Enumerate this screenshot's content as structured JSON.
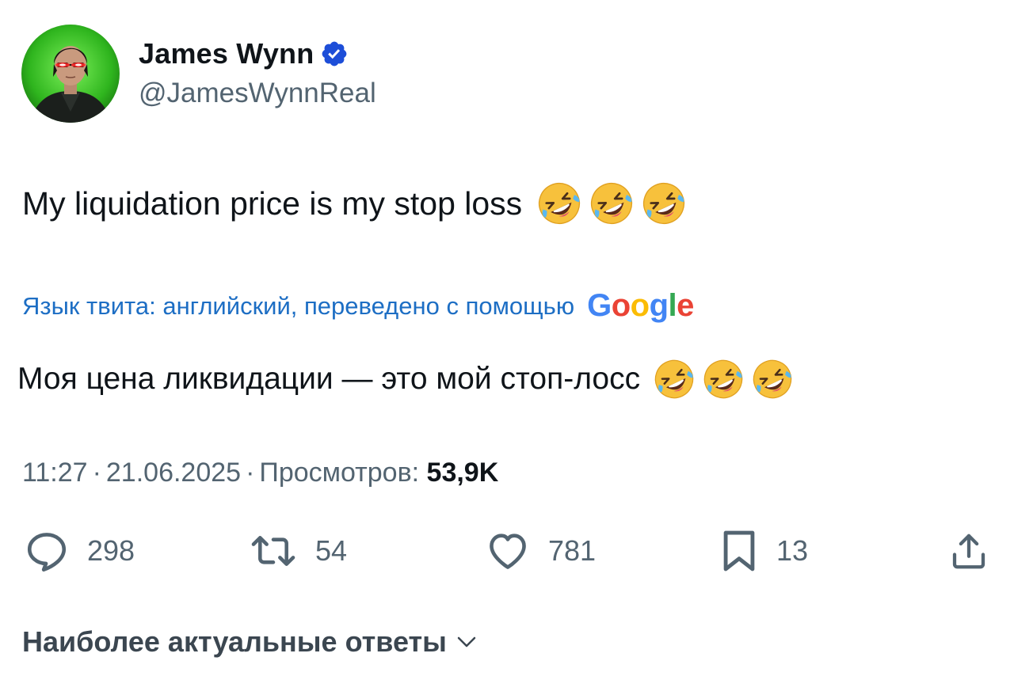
{
  "author": {
    "display_name": "James Wynn",
    "handle": "@JamesWynnReal",
    "verified_color": "#1d4ed8"
  },
  "tweet": {
    "text": "My liquidation price is my stop loss",
    "emojis": [
      "rolling-on-floor-laughing",
      "rolling-on-floor-laughing",
      "rolling-on-floor-laughing"
    ]
  },
  "translation": {
    "label": "Язык твита: английский, переведено с помощью",
    "provider": "Google",
    "text": "Моя цена ликвидации — это мой стоп-лосс"
  },
  "meta": {
    "time": "11:27",
    "date": "21.06.2025",
    "views_label": "Просмотров:",
    "views_value": "53,9K"
  },
  "actions": {
    "replies": "298",
    "retweets": "54",
    "likes": "781",
    "bookmarks": "13"
  },
  "replies_sort": {
    "label": "Наиболее актуальные ответы"
  },
  "colors": {
    "text_primary": "#0f1419",
    "text_secondary": "#536471",
    "link": "#1d6ec4"
  }
}
